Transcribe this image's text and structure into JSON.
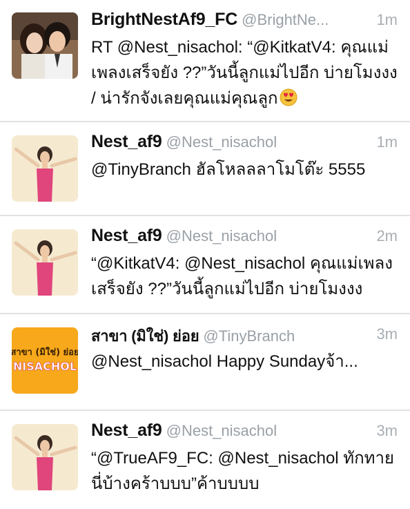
{
  "tweets": [
    {
      "display_name": "BrightNestAf9_FC",
      "handle": "@BrightNe...",
      "time": "1m",
      "text": "RT @Nest_nisachol: “@KitkatV4: คุณแม่เพลงเสร็จยัง ??”วันนี้ลูกแม่ไปอีก บ่ายโมงงง / น่ารักจังเลยคุณแม่คุณลูก",
      "emoji": "heart-eyes-emoji"
    },
    {
      "display_name": "Nest_af9",
      "handle": "@Nest_nisachol",
      "time": "1m",
      "text": "@TinyBranch  ฮัลโหลลลาโมโต๊ะ 5555"
    },
    {
      "display_name": "Nest_af9",
      "handle": "@Nest_nisachol",
      "time": "2m",
      "text": "“@KitkatV4: @Nest_nisachol คุณแม่เพลงเสร็จยัง ??”วันนี้ลูกแม่ไปอีก บ่ายโมงงง"
    },
    {
      "display_name": "สาขา (มิใช่) ย่อย",
      "handle": "@TinyBranch",
      "time": "3m",
      "text": "@Nest_nisachol Happy Sundayจ้า...",
      "avatar_text_top": "สาขา (มิใช่) ย่อย",
      "avatar_text_bottom": "NISACHOL"
    },
    {
      "display_name": "Nest_af9",
      "handle": "@Nest_nisachol",
      "time": "3m",
      "text": "“@TrueAF9_FC: @Nest_nisachol ทักทายนี่บ้างคร้าบบบ”ค้าบบบบ"
    }
  ],
  "colors": {
    "name": "#111111",
    "handle": "#9aa0a6",
    "time": "#a9aeb3",
    "divider": "#dfe1e4",
    "branch_avatar_bg": "#f7a81b"
  }
}
